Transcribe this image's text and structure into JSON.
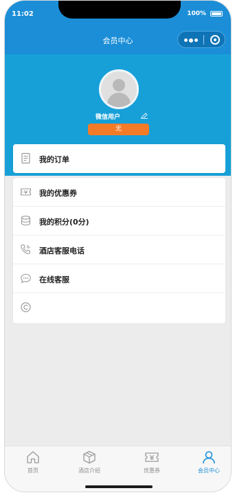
{
  "status_bar": {
    "time": "11:02",
    "battery": "100%"
  },
  "nav": {
    "title": "会员中心"
  },
  "profile": {
    "username": "微信用户",
    "level": "无",
    "avatar_icon": "user-avatar-icon",
    "edit_icon": "pencil-icon"
  },
  "orders": {
    "label": "我的订单",
    "icon": "document-icon"
  },
  "menu": [
    {
      "label": "我的优惠券",
      "icon": "coupon-icon"
    },
    {
      "label": "我的积分(0分)",
      "icon": "coins-stack-icon"
    },
    {
      "label": "酒店客服电话",
      "icon": "phone-icon"
    },
    {
      "label": "在线客服",
      "icon": "chat-icon"
    },
    {
      "label": "",
      "icon": "copyright-icon"
    }
  ],
  "tabbar": [
    {
      "label": "首页",
      "icon": "home-icon",
      "active": false
    },
    {
      "label": "酒店介绍",
      "icon": "box-icon",
      "active": false
    },
    {
      "label": "优惠券",
      "icon": "coupon-icon",
      "active": false
    },
    {
      "label": "会员中心",
      "icon": "person-icon",
      "active": true
    }
  ],
  "colors": {
    "primary": "#1b8ed7",
    "header_bg": "#17a0d8",
    "badge": "#f37b27",
    "page_bg": "#ececec"
  }
}
